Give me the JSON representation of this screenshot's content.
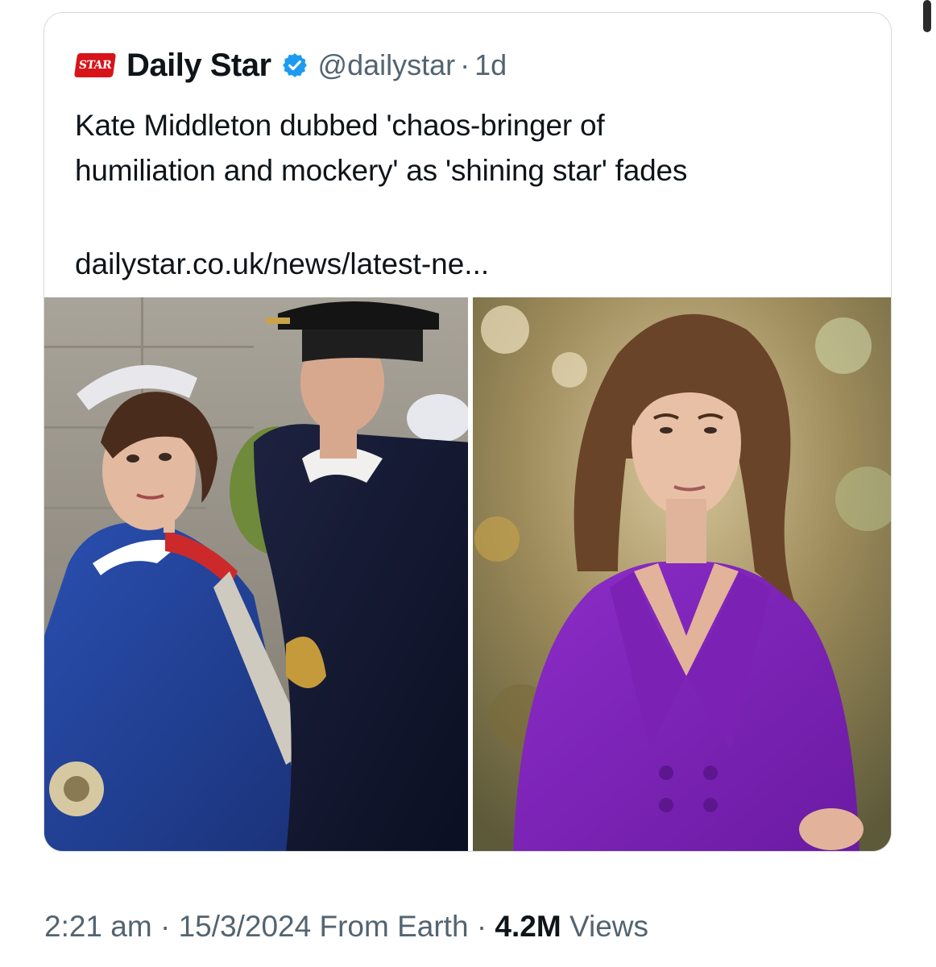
{
  "quoted_tweet": {
    "logo_text": "STAR",
    "display_name": "Daily Star",
    "handle": "@dailystar",
    "separator": "·",
    "time_ago": "1d",
    "text_line1": "Kate Middleton dubbed 'chaos-bringer of",
    "text_line2": "humiliation and mockery' as 'shining star' fades",
    "link": "dailystar.co.uk/news/latest-ne..."
  },
  "meta": {
    "time": "2:21 am",
    "separator1": "·",
    "date": "15/3/2024",
    "source": "From Earth",
    "separator2": "·",
    "views_count": "4.2M",
    "views_label": "Views"
  },
  "colors": {
    "text_primary": "#0f1419",
    "text_secondary": "#536471",
    "verified_blue": "#1d9bf0",
    "border": "#d4dade",
    "logo_red": "#d7141a"
  },
  "icons": {
    "verified": "verified-badge-icon",
    "logo": "daily-star-logo"
  }
}
